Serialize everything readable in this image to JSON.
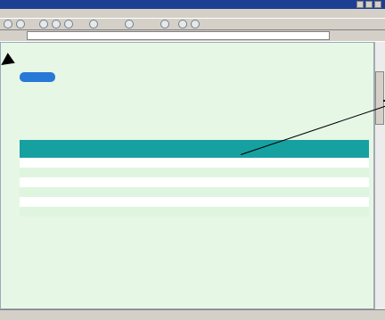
{
  "window": {
    "title": ""
  },
  "menu": [],
  "address": {
    "label": "",
    "value": "",
    "go": ""
  },
  "breadcrumb": "",
  "page_button": "",
  "description": "",
  "section_title": "",
  "table": {
    "headers": [
      "",
      "",
      "",
      ""
    ],
    "rows": [
      {
        "name": "",
        "line1": "",
        "link": "",
        "d1": "",
        "d2": ""
      },
      {
        "name": "",
        "line1": "",
        "link": "",
        "d1": "",
        "d2": ""
      },
      {
        "name": "",
        "line1": "",
        "link": "",
        "d1": "",
        "d2": ""
      },
      {
        "name": "",
        "line1": "",
        "link": "",
        "d1": "",
        "d2": ""
      },
      {
        "name": "",
        "line1": "",
        "link": "",
        "d1": "",
        "d2": ""
      },
      {
        "name": "",
        "line1": "",
        "link": "",
        "d1": "",
        "d2": ""
      },
      {
        "name": "",
        "line1": "",
        "link": "",
        "d1": "",
        "d2": ""
      }
    ]
  },
  "status": {
    "text": ""
  },
  "colors": {
    "accent": "#16a0a0",
    "header_green": "#3cb83c",
    "link": "#2a4fd0",
    "page_bg": "#e6f7e6"
  },
  "icons": [
    "back-icon",
    "forward-icon",
    "stop-icon",
    "refresh-icon",
    "home-icon",
    "search-icon",
    "favorites-icon",
    "history-icon",
    "mail-icon",
    "print-icon",
    "minimize-icon",
    "maximize-icon",
    "close-icon"
  ]
}
